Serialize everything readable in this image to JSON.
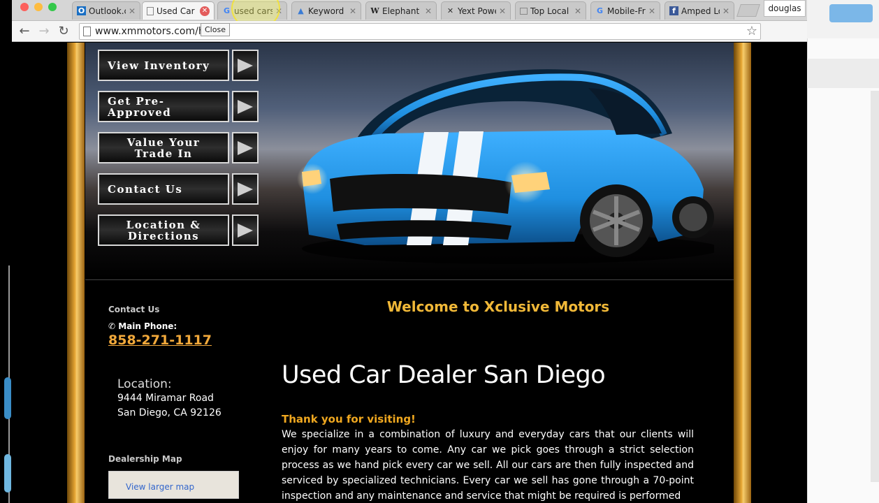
{
  "browser": {
    "tabs": [
      {
        "title": "Outlook.co",
        "icon": "outlook-icon",
        "active": false
      },
      {
        "title": "Used Car",
        "icon": "page-icon",
        "active": true
      },
      {
        "title": "used cars",
        "icon": "google-icon",
        "active": false
      },
      {
        "title": "Keyword P",
        "icon": "adwords-icon",
        "active": false
      },
      {
        "title": "Elephant",
        "icon": "wikipedia-icon",
        "active": false
      },
      {
        "title": "Yext Powe",
        "icon": "yext-icon",
        "active": false
      },
      {
        "title": "Top Local",
        "icon": "page-icon",
        "active": false
      },
      {
        "title": "Mobile-Fr",
        "icon": "google-icon",
        "active": false
      },
      {
        "title": "Amped Lo",
        "icon": "facebook-icon",
        "active": false
      }
    ],
    "profile_name": "douglas",
    "url": "www.xmmotors.com/ho",
    "tooltip": "Close"
  },
  "nav_menu": [
    {
      "label": "View Inventory"
    },
    {
      "label": "Get Pre-Approved"
    },
    {
      "label": "Value Your Trade In"
    },
    {
      "label": "Contact Us"
    },
    {
      "label": "Location & Directions"
    }
  ],
  "sidebar": {
    "contact_heading": "Contact Us",
    "phone_label": "Main Phone:",
    "phone": "858-271-1117",
    "location_title": "Location:",
    "address_line1": "9444 Miramar Road",
    "address_line2": "San Diego, CA 92126",
    "map_heading": "Dealership Map",
    "map_link": "View larger map"
  },
  "content": {
    "welcome": "Welcome to Xclusive Motors",
    "title": "Used Car Dealer San Diego",
    "thanks": "Thank you for visiting!",
    "body": "We specialize in a combination of luxury and everyday cars that our clients will enjoy for many years to come. Any car we pick goes through a strict selection process as we hand pick every car we sell. All our cars are then fully inspected and serviced by specialized technicians. Every car we sell has gone through a 70-point inspection and any maintenance and service that might be required is performed"
  },
  "colors": {
    "accent_gold": "#f0b838",
    "phone_orange": "#f2a93b",
    "car_blue": "#1f8fe0"
  }
}
